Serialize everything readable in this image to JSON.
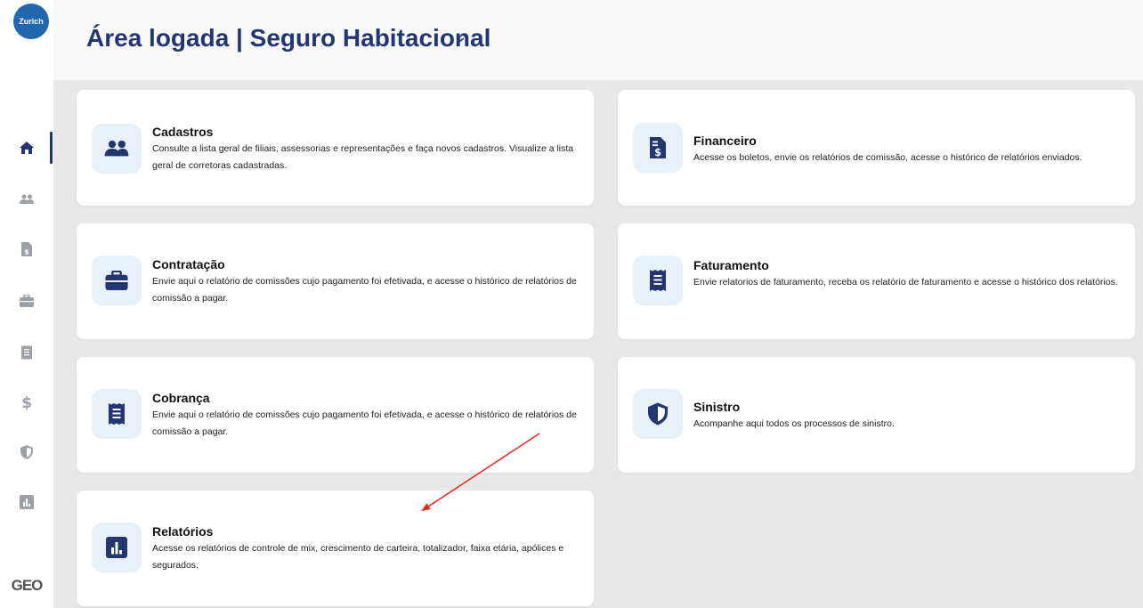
{
  "brand": {
    "logo_text": "Zurich",
    "footer_logo": "GEO",
    "accent": "#2167ae",
    "navy": "#23366f"
  },
  "header": {
    "title": "Área logada | Seguro Habitacional",
    "chevron_icon": "chevron-down-icon"
  },
  "sidebar": {
    "items": [
      {
        "name": "home",
        "icon": "home-icon",
        "active": true
      },
      {
        "name": "cadastros",
        "icon": "users-icon",
        "active": false
      },
      {
        "name": "financeiro",
        "icon": "invoice-icon",
        "active": false
      },
      {
        "name": "contratacao",
        "icon": "briefcase-icon",
        "active": false
      },
      {
        "name": "faturamento",
        "icon": "receipt-icon",
        "active": false
      },
      {
        "name": "cobranca",
        "icon": "dollar-icon",
        "active": false
      },
      {
        "name": "sinistro",
        "icon": "shield-icon",
        "active": false
      },
      {
        "name": "relatorios",
        "icon": "chart-icon",
        "active": false
      }
    ]
  },
  "cards": {
    "cadastros": {
      "title": "Cadastros",
      "desc": "Consulte a lista geral de filiais, assessorias e representações e faça novos cadastros. Visualize a lista geral de corretoras cadastradas.",
      "icon": "users-icon"
    },
    "financeiro": {
      "title": "Financeiro",
      "desc": "Acesse os boletos, envie os relatórios de comissão, acesse o histórico de relatórios enviados.",
      "icon": "invoice-icon"
    },
    "contratacao": {
      "title": "Contratação",
      "desc": "Envie aqui o relatório de comissões cujo pagamento foi efetivada, e acesse o histórico de relatórios de comissão a pagar.",
      "icon": "briefcase-icon"
    },
    "faturamento": {
      "title": "Faturamento",
      "desc": "Envie relatorios de faturamento, receba os relatório de faturamento e acesse o histórico dos relatórios.",
      "icon": "receipt-icon"
    },
    "cobranca": {
      "title": "Cobrança",
      "desc": "Envie aqui o relatório de comissões cujo pagamento foi efetivada, e acesse o histórico de relatórios de comissão a pagar.",
      "icon": "receipt-icon"
    },
    "sinistro": {
      "title": "Sinistro",
      "desc": "Acompanhe aqui todos os processos de sinistro.",
      "icon": "shield-icon"
    },
    "relatorios": {
      "title": "Relatórios",
      "desc": "Acesse os relatórios de controle de mix, crescimento de carteira, totalizador, faixa etária, apólices e segurados.",
      "icon": "chart-icon"
    }
  },
  "annotation": {
    "color": "#e8261e"
  }
}
